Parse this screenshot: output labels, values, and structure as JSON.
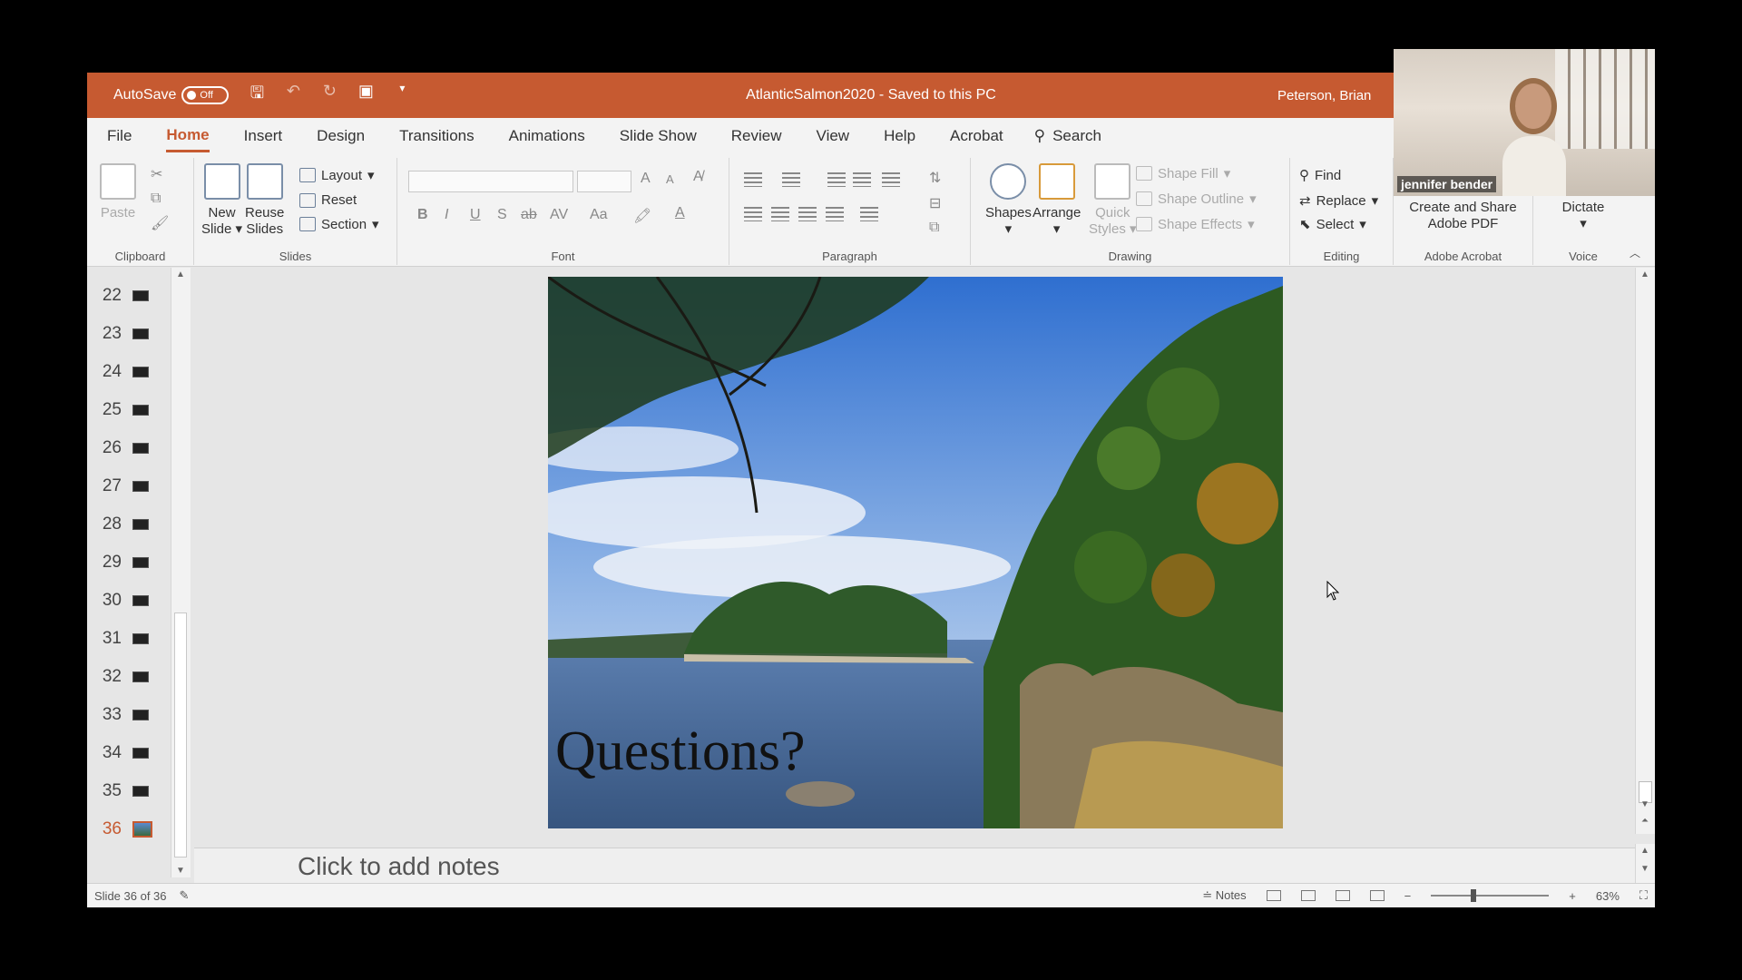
{
  "titlebar": {
    "autosave_label": "AutoSave",
    "autosave_state": "Off",
    "document_title": "AtlanticSalmon2020",
    "save_status": "Saved to this PC",
    "user_name": "Peterson, Brian"
  },
  "tabs": [
    {
      "label": "File"
    },
    {
      "label": "Home",
      "active": true
    },
    {
      "label": "Insert"
    },
    {
      "label": "Design"
    },
    {
      "label": "Transitions"
    },
    {
      "label": "Animations"
    },
    {
      "label": "Slide Show"
    },
    {
      "label": "Review"
    },
    {
      "label": "View"
    },
    {
      "label": "Help"
    },
    {
      "label": "Acrobat"
    }
  ],
  "search_label": "Search",
  "ribbon": {
    "clipboard": {
      "label": "Clipboard",
      "paste": "Paste"
    },
    "slides": {
      "label": "Slides",
      "new_slide": [
        "New",
        "Slide"
      ],
      "reuse_slides": [
        "Reuse",
        "Slides"
      ],
      "layout": "Layout",
      "reset": "Reset",
      "section": "Section"
    },
    "font": {
      "label": "Font",
      "bold": "B",
      "italic": "I",
      "underline": "U",
      "shadow": "S",
      "strike": "ab",
      "spacing": "AV",
      "case": "Aa",
      "grow": "A",
      "shrink": "A"
    },
    "paragraph": {
      "label": "Paragraph"
    },
    "drawing": {
      "label": "Drawing",
      "shapes": "Shapes",
      "arrange": "Arrange",
      "quick_styles": [
        "Quick",
        "Styles"
      ],
      "shape_fill": "Shape Fill",
      "shape_outline": "Shape Outline",
      "shape_effects": "Shape Effects"
    },
    "editing": {
      "label": "Editing",
      "find": "Find",
      "replace": "Replace",
      "select": "Select"
    },
    "acrobat": {
      "label": "Adobe Acrobat",
      "create": [
        "Create and Share",
        "Adobe PDF"
      ]
    },
    "voice": {
      "label": "Voice",
      "dictate": "Dictate"
    }
  },
  "webcam": {
    "participant_name": "jennifer bender"
  },
  "thumbnails": [
    {
      "num": "22"
    },
    {
      "num": "23"
    },
    {
      "num": "24"
    },
    {
      "num": "25"
    },
    {
      "num": "26"
    },
    {
      "num": "27"
    },
    {
      "num": "28"
    },
    {
      "num": "29"
    },
    {
      "num": "30"
    },
    {
      "num": "31"
    },
    {
      "num": "32"
    },
    {
      "num": "33"
    },
    {
      "num": "34"
    },
    {
      "num": "35"
    },
    {
      "num": "36",
      "active": true
    }
  ],
  "slide": {
    "title": "Questions?"
  },
  "notes": {
    "placeholder": "Click to add notes"
  },
  "status": {
    "slide_info": "Slide 36 of 36",
    "notes_button": "Notes",
    "zoom": "63%"
  },
  "colors": {
    "accent": "#c65a31",
    "active_tab": "#c65a31"
  }
}
